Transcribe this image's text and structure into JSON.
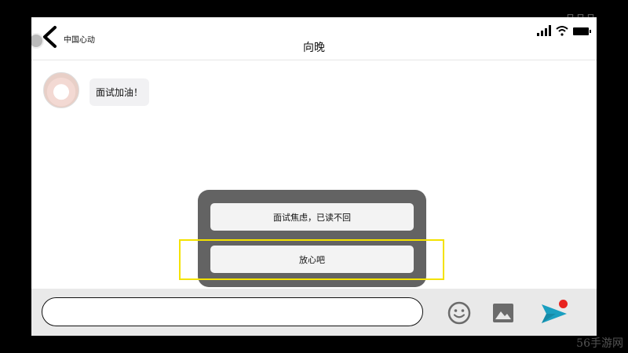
{
  "header": {
    "carrier": "中国心动",
    "title": "向晚"
  },
  "messages": [
    {
      "sender": "contact",
      "text": "面试加油！"
    }
  ],
  "choices": [
    {
      "label": "面试焦虑，已读不回"
    },
    {
      "label": "放心吧"
    }
  ],
  "selected_choice": 1,
  "input": {
    "value": "",
    "placeholder": ""
  },
  "icons": {
    "back": "chevron-left-icon",
    "emoji": "smiley-icon",
    "image": "image-icon",
    "send": "send-icon"
  },
  "colors": {
    "highlight": "#f4e200",
    "popup": "#636363",
    "send": "#1a9fc0",
    "badge": "#e8231f"
  },
  "watermarks": {
    "bottom": "56手游网"
  }
}
